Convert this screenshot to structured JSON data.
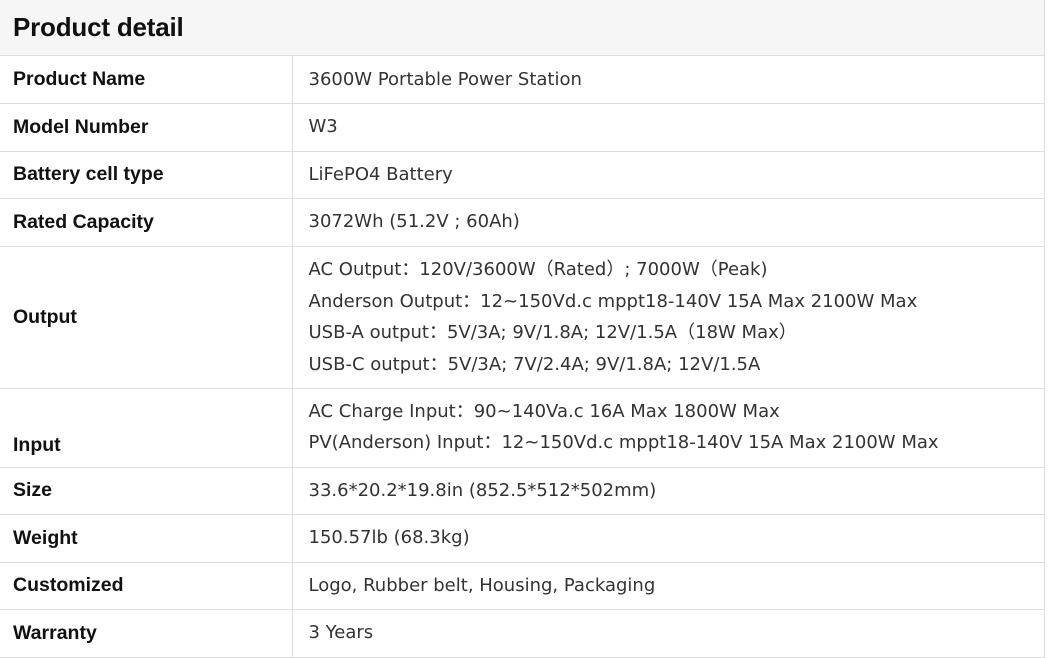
{
  "title": "Product detail",
  "rows": [
    {
      "label": "Product Name",
      "lines": [
        "3600W Portable Power Station"
      ]
    },
    {
      "label": "Model Number",
      "lines": [
        "W3"
      ]
    },
    {
      "label": "Battery cell type",
      "lines": [
        "LiFePO4 Battery"
      ]
    },
    {
      "label": "Rated Capacity",
      "lines": [
        "3072Wh (51.2V ; 60Ah)"
      ]
    },
    {
      "label": "Output",
      "lines": [
        "AC Output：120V/3600W（Rated）; 7000W（Peak)",
        "Anderson Output：12~150Vd.c mppt18-140V 15A Max 2100W Max",
        "USB-A output：5V/3A; 9V/1.8A; 12V/1.5A（18W Max）",
        "USB-C output：5V/3A; 7V/2.4A; 9V/1.8A; 12V/1.5A"
      ]
    },
    {
      "label": "Input",
      "lines": [
        "AC Charge Input：90~140Va.c 16A Max 1800W Max",
        "PV(Anderson) Input：12~150Vd.c mppt18-140V 15A Max 2100W Max"
      ]
    },
    {
      "label": "Size",
      "lines": [
        "33.6*20.2*19.8in (852.5*512*502mm)"
      ]
    },
    {
      "label": "Weight",
      "lines": [
        "150.57lb (68.3kg)"
      ]
    },
    {
      "label": "Customized",
      "lines": [
        "Logo, Rubber belt, Housing, Packaging"
      ]
    },
    {
      "label": "Warranty",
      "lines": [
        "3 Years"
      ]
    }
  ]
}
